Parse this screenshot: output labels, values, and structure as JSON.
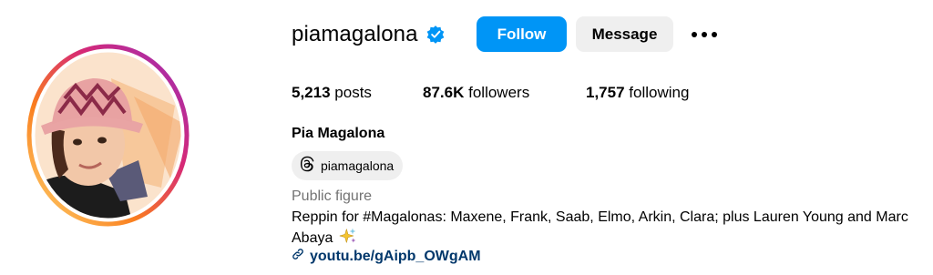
{
  "profile": {
    "username": "piamagalona",
    "verified": true,
    "full_name": "Pia Magalona",
    "category": "Public figure",
    "bio_text": "Reppin for #Magalonas: Maxene, Frank, Saab, Elmo, Arkin, Clara; plus Lauren Young and Marc Abaya",
    "bio_emoji": "sparkles-icon",
    "link": "youtu.be/gAipb_OWgAM",
    "threads_handle": "piamagalona"
  },
  "actions": {
    "follow_label": "Follow",
    "message_label": "Message",
    "more_icon": "more-options-icon"
  },
  "stats": {
    "posts_count": "5,213",
    "posts_label": "posts",
    "followers_count": "87.6K",
    "followers_label": "followers",
    "following_count": "1,757",
    "following_label": "following"
  },
  "colors": {
    "follow_button": "#0095f6",
    "verified_badge": "#0095f6",
    "link": "#00376b",
    "secondary_text": "#737373",
    "button_gray": "#efefef",
    "ring_gradient": [
      "#feda75",
      "#fa7e1e",
      "#d62976",
      "#962fbf"
    ]
  }
}
